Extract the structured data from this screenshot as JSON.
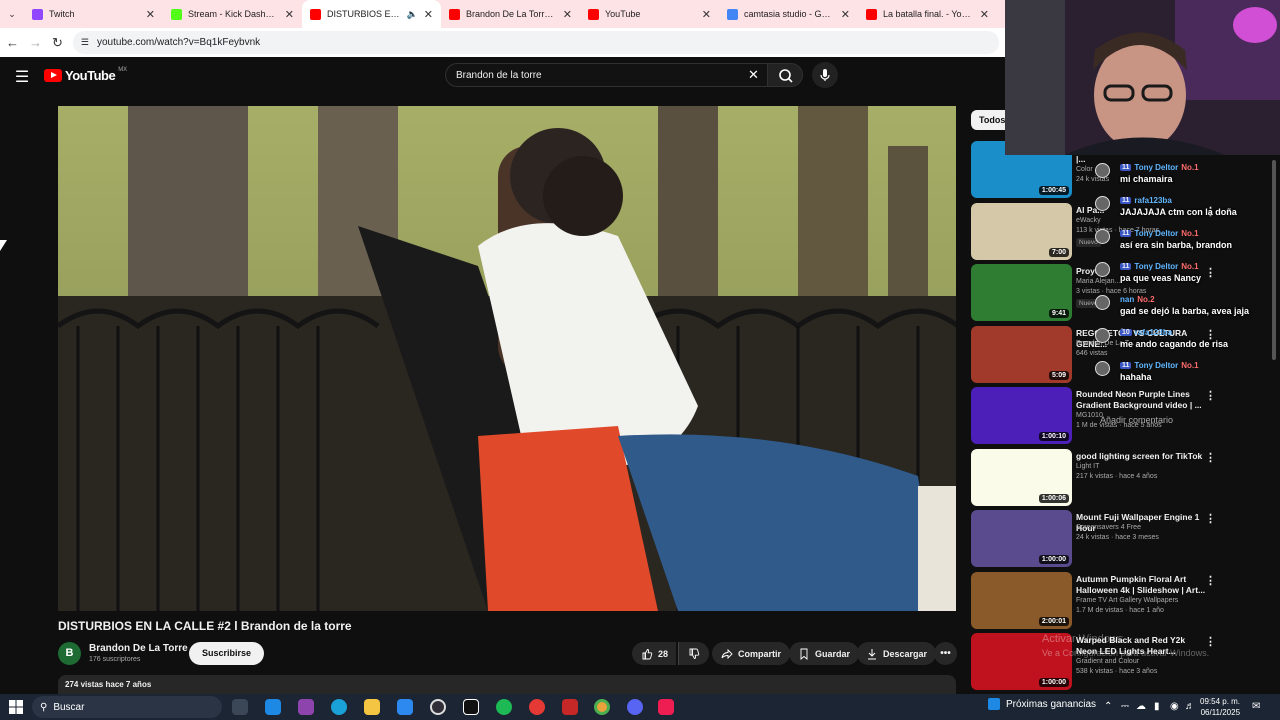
{
  "browser": {
    "tabs": [
      {
        "title": "Twitch",
        "color": "#9146ff",
        "active": false
      },
      {
        "title": "Stream - Kick Dashboard",
        "color": "#53fc18",
        "active": false
      },
      {
        "title": "DISTURBIOS EN LA CA",
        "color": "#ff0000",
        "active": true
      },
      {
        "title": "Brandon De La Torre - You",
        "color": "#ff0000",
        "active": false
      },
      {
        "title": "YouTube",
        "color": "#ff0000",
        "active": false
      },
      {
        "title": "camtasia studio - Google",
        "color": "#4285f4",
        "active": false
      },
      {
        "title": "La batalla final. - YouTube",
        "color": "#ff0000",
        "active": false
      }
    ],
    "url": "youtube.com/watch?v=Bq1kFeybvnk"
  },
  "header": {
    "logo_text": "YouTube",
    "region": "MX",
    "search_value": "Brandon de la torre"
  },
  "video": {
    "title": "DISTURBIOS EN LA CALLE #2 l Brandon de la torre",
    "channel": "Brandon De La Torre",
    "channel_initial": "B",
    "subscribers": "176 suscriptores",
    "subscribe_label": "Suscribirse",
    "likes": "28",
    "share_label": "Compartir",
    "save_label": "Guardar",
    "download_label": "Descargar",
    "views_date": "274 vistas  hace 7 años"
  },
  "sidebar": {
    "chip": "Todos",
    "recommendations": [
      {
        "title": "Lights| Radial gradient colors |...",
        "channel": "Color",
        "meta": "24 k vistas",
        "duration": "1:00:45",
        "thumb": "#1a8ec9"
      },
      {
        "title": "Al Pa...",
        "channel": "eWacky",
        "meta": "113 k vistas · hace 7 horas",
        "badge": "Nuevo",
        "duration": "7:00",
        "thumb": "#d4c8a8"
      },
      {
        "title": "Proye...",
        "channel": "Maria Alejan...",
        "meta": "3 vistas · hace 6 horas",
        "badge": "Nuevo",
        "duration": "9:41",
        "thumb": "#2e7d32"
      },
      {
        "title": "REGGAETÓN VS CULTURA GENE...",
        "channel": "Brandon De La T...",
        "meta": "646 vistas",
        "duration": "5:09",
        "thumb": "#a13a2a"
      },
      {
        "title": "Rounded Neon Purple Lines Gradient Background video | ...",
        "channel": "MG1010",
        "meta": "1 M de vistas · hace 5 años",
        "duration": "1:00:10",
        "thumb": "#4b1fb8"
      },
      {
        "title": "good lighting screen for TikTok",
        "channel": "Light IT",
        "meta": "217 k vistas · hace 4 años",
        "duration": "1:00:06",
        "thumb": "#fafbe8"
      },
      {
        "title": "Mount Fuji Wallpaper Engine 1 Hour",
        "channel": "Screensavers 4 Free",
        "meta": "24 k vistas · hace 3 meses",
        "duration": "1:00:00",
        "thumb": "#5a4a8e"
      },
      {
        "title": "Autumn Pumpkin Floral Art Halloween 4k | Slideshow | Art...",
        "channel": "Frame TV Art Gallery Wallpapers",
        "meta": "1.7 M de vistas · hace 1 año",
        "duration": "2:00:01",
        "thumb": "#8a5a2a"
      },
      {
        "title": "Warped Black and Red Y2k Neon LED Lights Heart...",
        "channel": "Gradient and Colour",
        "meta": "538 k vistas · hace 3 años",
        "duration": "1:00:00",
        "thumb": "#c0121e"
      }
    ]
  },
  "chat": {
    "messages": [
      {
        "level": "11",
        "user": "Tony Deltor",
        "rank": "No.1",
        "text": "mi chamaira"
      },
      {
        "level": "11",
        "user": "rafa123ba",
        "rank": "",
        "text": "JAJAJAJA ctm con la doña"
      },
      {
        "level": "11",
        "user": "Tony Deltor",
        "rank": "No.1",
        "text": "así era sin barba, brandon"
      },
      {
        "level": "11",
        "user": "Tony Deltor",
        "rank": "No.1",
        "text": "pa que veas Nancy"
      },
      {
        "level": "",
        "user": "nan",
        "rank": "No.2",
        "text": "gad se dejó la barba, avea jaja"
      },
      {
        "level": "10",
        "user": "rafa123ba",
        "rank": "",
        "text": "me ando cagando de risa"
      },
      {
        "level": "11",
        "user": "Tony Deltor",
        "rank": "No.1",
        "text": "hahaha"
      }
    ],
    "input_placeholder": "Añadir comentario"
  },
  "watermark": {
    "title": "Activar Windows",
    "subtitle": "Ve a Configuración para activar Windows."
  },
  "taskbar": {
    "search_placeholder": "Buscar",
    "weather": "Próximas ganancias",
    "time": "09:54 p. m.",
    "date": "06/11/2025"
  }
}
